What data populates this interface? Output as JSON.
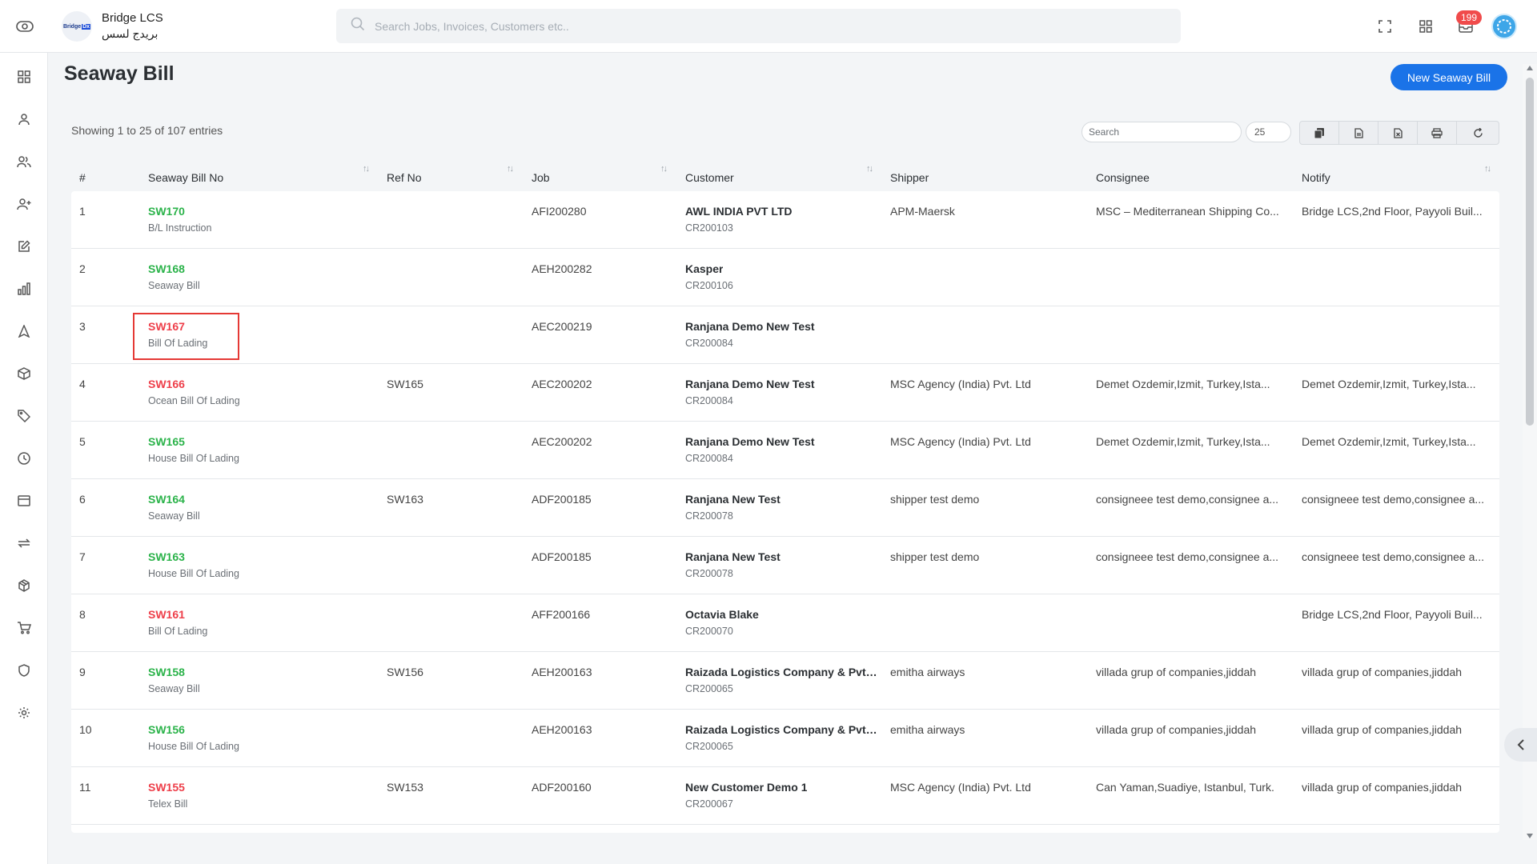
{
  "app": {
    "name": "Bridge LCS",
    "name_ar": "بريدج لسس",
    "logo_text_1": "Bridge",
    "logo_text_2": "Dx"
  },
  "topbar": {
    "search_placeholder": "Search Jobs, Invoices, Customers etc..",
    "notification_count": "199"
  },
  "page": {
    "title": "Seaway Bill",
    "new_button": "New Seaway Bill",
    "showing": "Showing 1 to 25 of 107 entries",
    "search_placeholder": "Search",
    "page_size": "25"
  },
  "table": {
    "columns": [
      "#",
      "Seaway Bill No",
      "Ref No",
      "Job",
      "Customer",
      "Shipper",
      "Consignee",
      "Notify"
    ],
    "rows": [
      {
        "num": "1",
        "bill_no": "SW170",
        "bill_type": "B/L Instruction",
        "status": "green",
        "ref_no": "",
        "job": "AFI200280",
        "customer": "AWL INDIA PVT LTD",
        "customer_code": "CR200103",
        "shipper": "APM-Maersk",
        "consignee": "MSC – Mediterranean Shipping Co...",
        "notify": "Bridge LCS,2nd Floor, Payyoli Buil..."
      },
      {
        "num": "2",
        "bill_no": "SW168",
        "bill_type": "Seaway Bill",
        "status": "green",
        "ref_no": "",
        "job": "AEH200282",
        "customer": "Kasper",
        "customer_code": "CR200106",
        "shipper": "",
        "consignee": "",
        "notify": ""
      },
      {
        "num": "3",
        "bill_no": "SW167",
        "bill_type": "Bill Of Lading",
        "status": "red",
        "ref_no": "",
        "job": "AEC200219",
        "customer": "Ranjana Demo New Test",
        "customer_code": "CR200084",
        "shipper": "",
        "consignee": "",
        "notify": ""
      },
      {
        "num": "4",
        "bill_no": "SW166",
        "bill_type": "Ocean Bill Of Lading",
        "status": "red",
        "ref_no": "SW165",
        "job": "AEC200202",
        "customer": "Ranjana Demo New Test",
        "customer_code": "CR200084",
        "shipper": "MSC Agency (India) Pvt. Ltd",
        "consignee": "Demet Ozdemir,Izmit, Turkey,Ista...",
        "notify": "Demet Ozdemir,Izmit, Turkey,Ista..."
      },
      {
        "num": "5",
        "bill_no": "SW165",
        "bill_type": "House Bill Of Lading",
        "status": "green",
        "ref_no": "",
        "job": "AEC200202",
        "customer": "Ranjana Demo New Test",
        "customer_code": "CR200084",
        "shipper": "MSC Agency (India) Pvt. Ltd",
        "consignee": "Demet Ozdemir,Izmit, Turkey,Ista...",
        "notify": "Demet Ozdemir,Izmit, Turkey,Ista..."
      },
      {
        "num": "6",
        "bill_no": "SW164",
        "bill_type": "Seaway Bill",
        "status": "green",
        "ref_no": "SW163",
        "job": "ADF200185",
        "customer": "Ranjana New Test",
        "customer_code": "CR200078",
        "shipper": "shipper test demo",
        "consignee": "consigneee test demo,consignee a...",
        "notify": "consigneee test demo,consignee a..."
      },
      {
        "num": "7",
        "bill_no": "SW163",
        "bill_type": "House Bill Of Lading",
        "status": "green",
        "ref_no": "",
        "job": "ADF200185",
        "customer": "Ranjana New Test",
        "customer_code": "CR200078",
        "shipper": "shipper test demo",
        "consignee": "consigneee test demo,consignee a...",
        "notify": "consigneee test demo,consignee a..."
      },
      {
        "num": "8",
        "bill_no": "SW161",
        "bill_type": "Bill Of Lading",
        "status": "red",
        "ref_no": "",
        "job": "AFF200166",
        "customer": "Octavia Blake",
        "customer_code": "CR200070",
        "shipper": "",
        "consignee": "",
        "notify": "Bridge LCS,2nd Floor, Payyoli Buil..."
      },
      {
        "num": "9",
        "bill_no": "SW158",
        "bill_type": "Seaway Bill",
        "status": "green",
        "ref_no": "SW156",
        "job": "AEH200163",
        "customer": "Raizada Logistics Company & Pvt ...",
        "customer_code": "CR200065",
        "shipper": "emitha airways",
        "consignee": "villada grup of companies,jiddah",
        "notify": "villada grup of companies,jiddah"
      },
      {
        "num": "10",
        "bill_no": "SW156",
        "bill_type": "House Bill Of Lading",
        "status": "green",
        "ref_no": "",
        "job": "AEH200163",
        "customer": "Raizada Logistics Company & Pvt ...",
        "customer_code": "CR200065",
        "shipper": "emitha airways",
        "consignee": "villada grup of companies,jiddah",
        "notify": "villada grup of companies,jiddah"
      },
      {
        "num": "11",
        "bill_no": "SW155",
        "bill_type": "Telex Bill",
        "status": "red",
        "ref_no": "SW153",
        "job": "ADF200160",
        "customer": "New Customer Demo 1",
        "customer_code": "CR200067",
        "shipper": "MSC Agency (India) Pvt. Ltd",
        "consignee": "Can Yaman,Suadiye, Istanbul, Turk.",
        "notify": "villada grup of companies,jiddah"
      }
    ]
  },
  "colors": {
    "accent": "#1a73e8",
    "status_green": "#2bb34a",
    "status_red": "#ee3f4a",
    "badge": "#f04b4b"
  }
}
